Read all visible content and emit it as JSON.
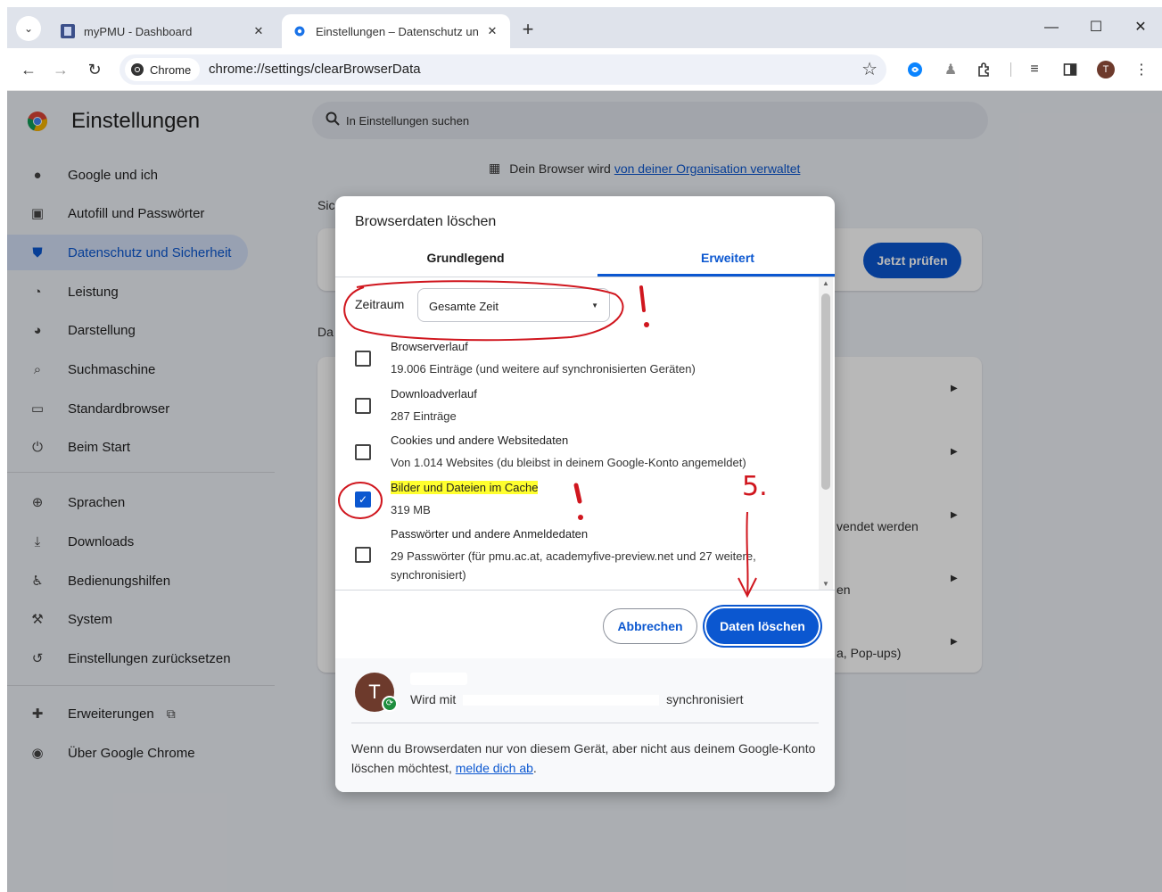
{
  "browser": {
    "tabs": [
      {
        "title": "myPMU - Dashboard",
        "active": false
      },
      {
        "title": "Einstellungen – Datenschutz un",
        "active": true
      }
    ],
    "new_tab": "+",
    "window_controls": {
      "minimize": "—",
      "maximize": "☐",
      "close": "✕"
    },
    "omnibox": {
      "chip": "Chrome",
      "url": "chrome://settings/clearBrowserData"
    },
    "profile_initial": "T"
  },
  "settings": {
    "title": "Einstellungen",
    "search_placeholder": "In Einstellungen suchen",
    "nav": [
      {
        "label": "Google und ich",
        "icon": "person-icon"
      },
      {
        "label": "Autofill und Passwörter",
        "icon": "clipboard-icon"
      },
      {
        "label": "Datenschutz und Sicherheit",
        "icon": "shield-icon",
        "active": true
      },
      {
        "label": "Leistung",
        "icon": "speedometer-icon"
      },
      {
        "label": "Darstellung",
        "icon": "palette-icon"
      },
      {
        "label": "Suchmaschine",
        "icon": "search-icon"
      },
      {
        "label": "Standardbrowser",
        "icon": "browser-icon"
      },
      {
        "label": "Beim Start",
        "icon": "power-icon"
      },
      {
        "label": "Sprachen",
        "icon": "globe-icon"
      },
      {
        "label": "Downloads",
        "icon": "download-icon"
      },
      {
        "label": "Bedienungshilfen",
        "icon": "accessibility-icon"
      },
      {
        "label": "System",
        "icon": "wrench-icon"
      },
      {
        "label": "Einstellungen zurücksetzen",
        "icon": "reset-icon"
      },
      {
        "label": "Erweiterungen",
        "icon": "puzzle-icon"
      },
      {
        "label": "Über Google Chrome",
        "icon": "chrome-icon"
      }
    ],
    "managed_prefix": "Dein Browser wird",
    "managed_link": "von deiner Organisation verwaltet",
    "bg_label_1": "Sic",
    "bg_label_2": "Da",
    "bg_button": "Jetzt prüfen",
    "bg_row_1": "vendet werden",
    "bg_row_2": "en",
    "bg_row_3": "a, Pop-ups)"
  },
  "dialog": {
    "title": "Browserdaten löschen",
    "tabs": [
      "Grundlegend",
      "Erweitert"
    ],
    "time_range_label": "Zeitraum",
    "time_range_value": "Gesamte Zeit",
    "items": [
      {
        "title": "Browserverlauf",
        "subtitle": "19.006 Einträge (und weitere auf synchronisierten Geräten)",
        "checked": false
      },
      {
        "title": "Downloadverlauf",
        "subtitle": "287 Einträge",
        "checked": false
      },
      {
        "title": "Cookies und andere Websitedaten",
        "subtitle": "Von 1.014 Websites (du bleibst in deinem Google-Konto angemeldet)",
        "checked": false
      },
      {
        "title": "Bilder und Dateien im Cache",
        "subtitle": "319 MB",
        "checked": true
      },
      {
        "title": "Passwörter und andere Anmeldedaten",
        "subtitle": "29 Passwörter (für pmu.ac.at, academyfive-preview.net und 27 weitere, synchronisiert)",
        "checked": false
      }
    ],
    "cancel_label": "Abbrechen",
    "delete_label": "Daten löschen",
    "account_initial": "T",
    "account_sync_prefix": "Wird mit",
    "account_sync_suffix": "synchronisiert",
    "note_text": "Wenn du Browserdaten nur von diesem Gerät, aber nicht aus deinem Google-Konto löschen möchtest,",
    "note_link": "melde dich ab",
    "note_end": "."
  },
  "annotations": {
    "step_label": "5.",
    "color": "#d0161e",
    "highlight_color": "#ffff2e"
  }
}
